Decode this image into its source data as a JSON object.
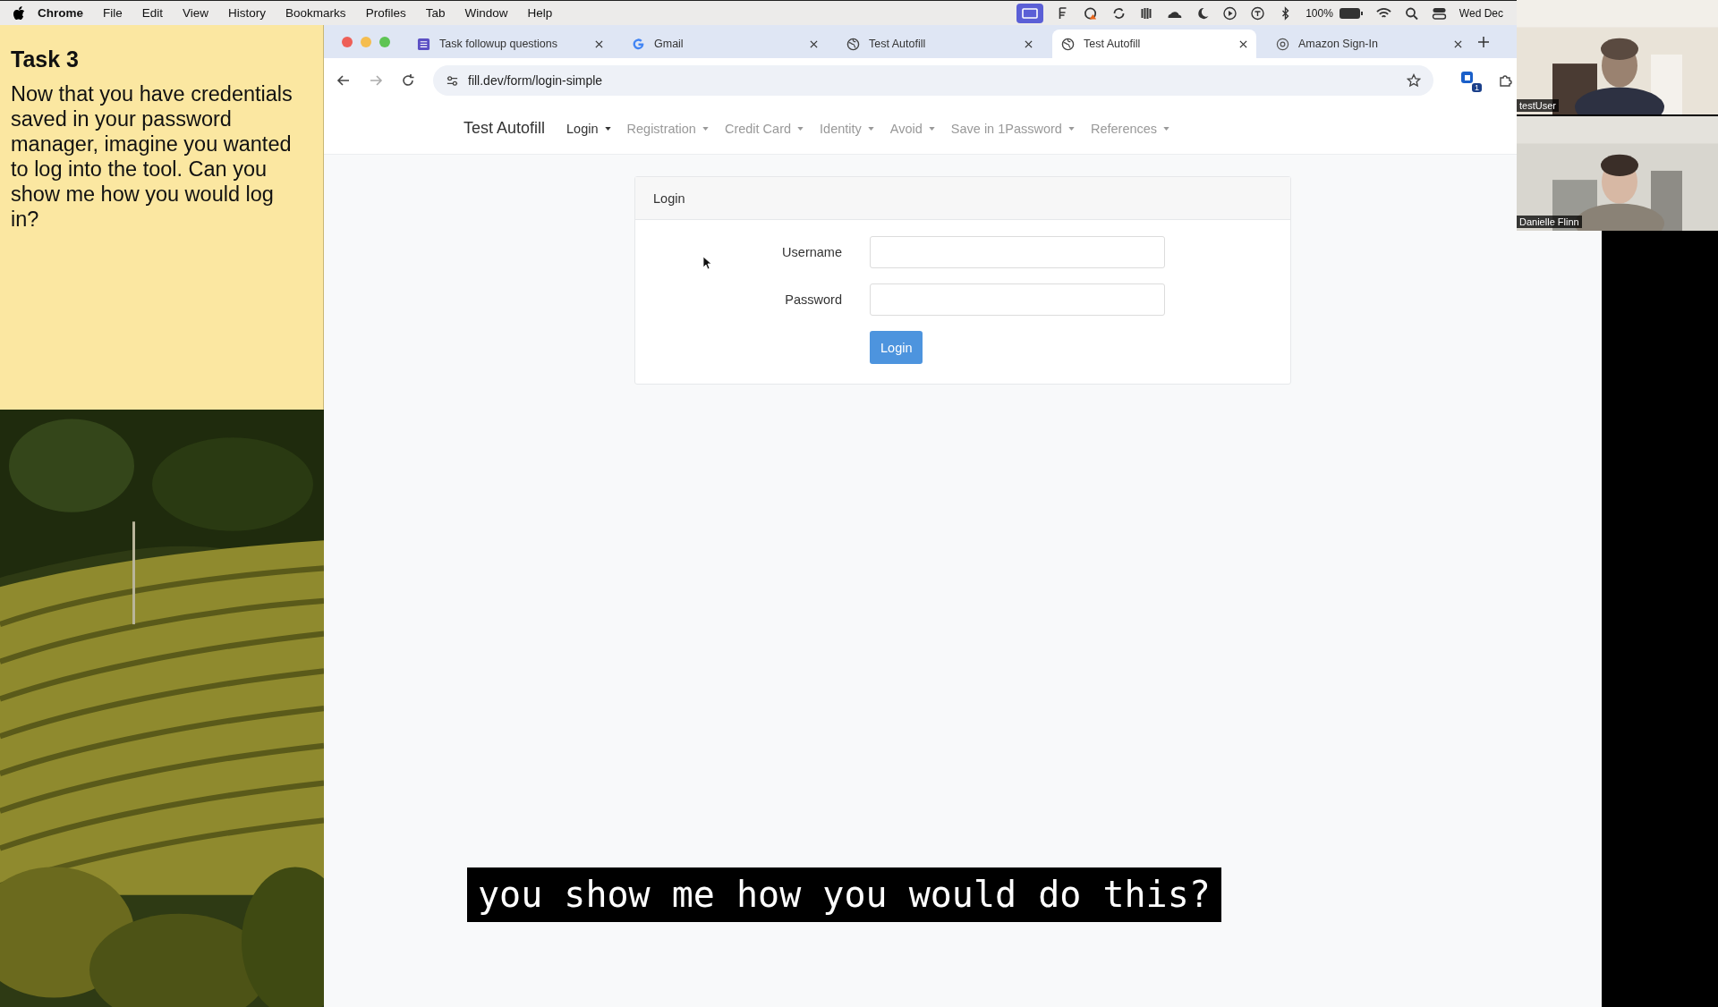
{
  "menu_bar": {
    "app": "Chrome",
    "menus": [
      "File",
      "Edit",
      "View",
      "History",
      "Bookmarks",
      "Profiles",
      "Tab",
      "Window",
      "Help"
    ],
    "battery": "100%",
    "clock": "Wed Dec"
  },
  "task_note": {
    "title": "Task 3",
    "text": "Now that you have credentials saved in your password manager, imagine you wanted to log into the tool. Can you show me how you would log in?"
  },
  "browser": {
    "tabs": [
      {
        "title": "Task followup questions",
        "selected": false,
        "kind": "form"
      },
      {
        "title": "Gmail",
        "selected": false,
        "kind": "google"
      },
      {
        "title": "Test Autofill",
        "selected": false,
        "kind": "globe"
      },
      {
        "title": "Test Autofill",
        "selected": true,
        "kind": "globe"
      },
      {
        "title": "Amazon Sign-In",
        "selected": false,
        "kind": "amazon"
      }
    ],
    "address": "fill.dev/form/login-simple",
    "extension_badge": "1"
  },
  "site": {
    "brand": "Test Autofill",
    "nav": [
      {
        "label": "Login",
        "active": true
      },
      {
        "label": "Registration",
        "active": false
      },
      {
        "label": "Credit Card",
        "active": false
      },
      {
        "label": "Identity",
        "active": false
      },
      {
        "label": "Avoid",
        "active": false
      },
      {
        "label": "Save in 1Password",
        "active": false
      },
      {
        "label": "References",
        "active": false
      }
    ]
  },
  "login_card": {
    "title": "Login",
    "fields": [
      {
        "label": "Username"
      },
      {
        "label": "Password"
      }
    ],
    "button": "Login"
  },
  "video_tiles": [
    {
      "name": "testUser"
    },
    {
      "name": "Danielle Flinn"
    }
  ],
  "caption": "you show me how you would do this?"
}
